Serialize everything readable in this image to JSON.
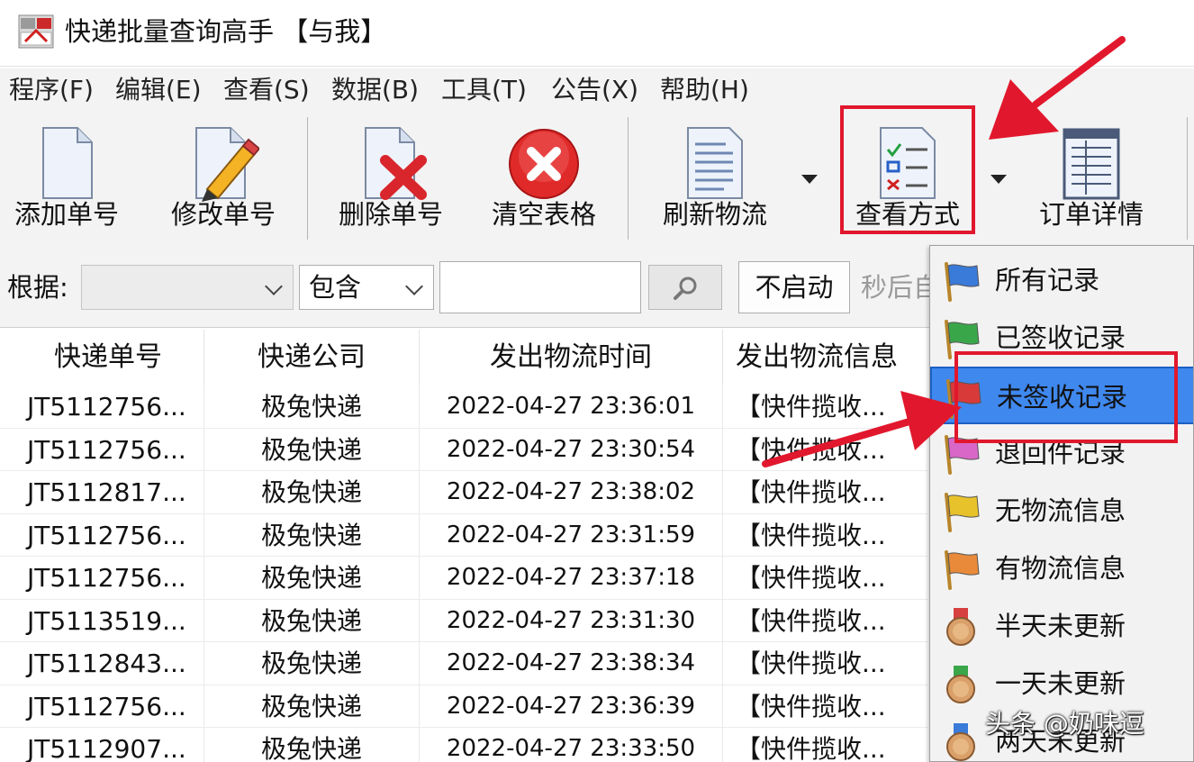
{
  "window": {
    "title": "快递批量查询高手 【与我】"
  },
  "menu": [
    "程序(F)",
    "编辑(E)",
    "查看(S)",
    "数据(B)",
    "工具(T)",
    "公告(X)",
    "帮助(H)"
  ],
  "toolbar": {
    "add": "添加单号",
    "edit": "修改单号",
    "delete": "删除单号",
    "clear": "清空表格",
    "refresh": "刷新物流",
    "view_mode": "查看方式",
    "order_detail": "订单详情"
  },
  "filter": {
    "basis_label": "根据:",
    "field_value": "",
    "match_value": "包含",
    "search_value": "",
    "toggle_label": "不启动",
    "seconds_text": "秒后自"
  },
  "grid": {
    "columns": [
      "快递单号",
      "快递公司",
      "发出物流时间",
      "发出物流信息"
    ],
    "rows": [
      [
        "JT5112756...",
        "极兔快递",
        "2022-04-27 23:36:01",
        "【快件揽收..."
      ],
      [
        "JT5112756...",
        "极兔快递",
        "2022-04-27 23:30:54",
        "【快件揽收..."
      ],
      [
        "JT5112817...",
        "极兔快递",
        "2022-04-27 23:38:02",
        "【快件揽收..."
      ],
      [
        "JT5112756...",
        "极兔快递",
        "2022-04-27 23:31:59",
        "【快件揽收..."
      ],
      [
        "JT5112756...",
        "极兔快递",
        "2022-04-27 23:37:18",
        "【快件揽收..."
      ],
      [
        "JT5113519...",
        "极兔快递",
        "2022-04-27 23:31:30",
        "【快件揽收..."
      ],
      [
        "JT5112843...",
        "极兔快递",
        "2022-04-27 23:38:34",
        "【快件揽收..."
      ],
      [
        "JT5112756...",
        "极兔快递",
        "2022-04-27 23:36:39",
        "【快件揽收..."
      ],
      [
        "JT5112907...",
        "极兔快递",
        "2022-04-27 23:33:50",
        "【快件揽收..."
      ]
    ]
  },
  "view_menu": {
    "items": [
      {
        "label": "所有记录",
        "icon": "blue-flag-icon",
        "selected": false
      },
      {
        "label": "已签收记录",
        "icon": "green-flag-icon",
        "selected": false
      },
      {
        "label": "未签收记录",
        "icon": "red-flag-icon",
        "selected": true
      },
      {
        "label": "退回件记录",
        "icon": "pink-flag-icon",
        "selected": false
      },
      {
        "label": "无物流信息",
        "icon": "yellow-flag-icon",
        "selected": false
      },
      {
        "label": "有物流信息",
        "icon": "orange-flag-icon",
        "selected": false
      },
      {
        "label": "半天未更新",
        "icon": "medal-red-icon",
        "selected": false
      },
      {
        "label": "一天未更新",
        "icon": "medal-green-icon",
        "selected": false
      },
      {
        "label": "两天未更新",
        "icon": "medal-blue-icon",
        "selected": false
      }
    ]
  },
  "colors": {
    "highlight": "#e1182d",
    "selection": "#3f88ee"
  },
  "watermark": "头条 @奶味逗"
}
